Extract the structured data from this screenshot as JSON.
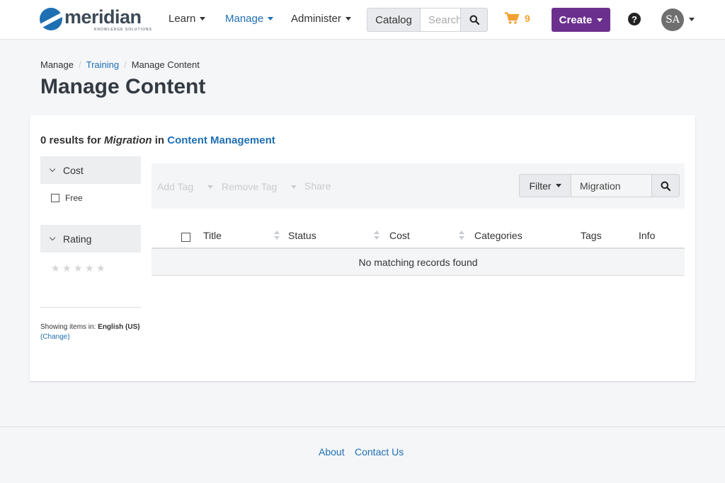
{
  "app": {
    "logo_word": "meridian",
    "logo_sub": "KNOWLEDGE SOLUTIONS"
  },
  "nav": {
    "learn": "Learn",
    "manage": "Manage",
    "administer": "Administer"
  },
  "search": {
    "catalog_label": "Catalog",
    "placeholder": "Search"
  },
  "cart": {
    "count": "9"
  },
  "create_label": "Create",
  "help_label": "?",
  "user": {
    "initials": "SA"
  },
  "breadcrumb": [
    "Manage",
    "Training",
    "Manage Content"
  ],
  "page_title": "Manage Content",
  "results": {
    "prefix": "0 results for",
    "query": "Migration",
    "in": "in",
    "scope": "Content Management"
  },
  "facets": {
    "cost": {
      "label": "Cost",
      "options": [
        "Free"
      ]
    },
    "rating": {
      "label": "Rating",
      "stars": 5
    }
  },
  "showing": {
    "prefix": "Showing items in:",
    "language": "English (US)",
    "change": "(Change)"
  },
  "toolbar": {
    "add_tag": "Add Tag",
    "remove_tag": "Remove Tag",
    "share": "Share",
    "filter": "Filter",
    "filter_value": "Migration"
  },
  "table": {
    "columns": [
      "Title",
      "Status",
      "Cost",
      "Categories",
      "Tags",
      "Info"
    ],
    "empty_message": "No matching records found"
  },
  "footer": {
    "about": "About",
    "contact": "Contact Us"
  },
  "colors": {
    "brand": "#1f6fb3",
    "create_button": "#6b2f8e",
    "cart": "#f0a030"
  }
}
